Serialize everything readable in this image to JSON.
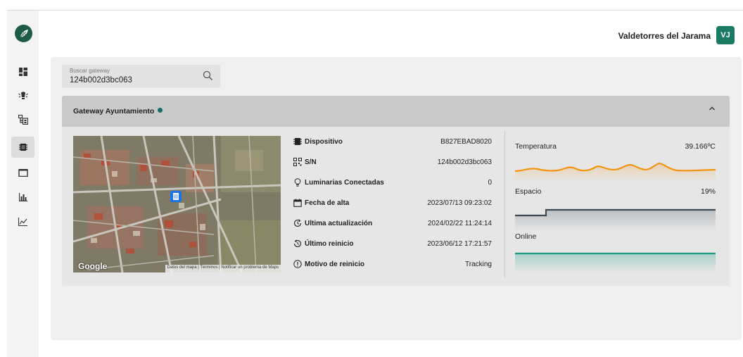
{
  "header": {
    "user_name": "Valdetorres del Jarama",
    "avatar_initials": "VJ"
  },
  "sidebar": {
    "items": [
      {
        "icon": "dashboard-icon",
        "active": false
      },
      {
        "icon": "alert-lamp-icon",
        "active": false
      },
      {
        "icon": "hierarchy-icon",
        "active": false
      },
      {
        "icon": "gateway-icon",
        "active": true
      },
      {
        "icon": "window-icon",
        "active": false
      },
      {
        "icon": "bar-chart-icon",
        "active": false
      },
      {
        "icon": "line-chart-icon",
        "active": false
      }
    ]
  },
  "search": {
    "label": "Buscar gateway",
    "value": "124b002d3bc063"
  },
  "gateway": {
    "title": "Gateway Ayuntamiento",
    "status_color": "#176b6b",
    "map": {
      "brand": "Google",
      "attribution": "Datos del mapa | Términos | Notificar un problema de Maps"
    },
    "info": [
      {
        "icon": "device-icon",
        "label": "Dispositivo",
        "value": "B827EBAD8020"
      },
      {
        "icon": "qr-icon",
        "label": "S/N",
        "value": "124b002d3bc063"
      },
      {
        "icon": "bulb-icon",
        "label": "Luminarias Conectadas",
        "value": "0"
      },
      {
        "icon": "calendar-icon",
        "label": "Fecha de alta",
        "value": "2023/07/13 09:23:02"
      },
      {
        "icon": "refresh-icon",
        "label": "Ultima actualización",
        "value": "2024/02/22 11:24:14"
      },
      {
        "icon": "restart-icon",
        "label": "Último reinicio",
        "value": "2023/06/12 17:21:57"
      },
      {
        "icon": "info-circle-icon",
        "label": "Motivo de reinicio",
        "value": "Tracking"
      }
    ],
    "metrics": {
      "temperatura": {
        "label": "Temperatura",
        "value": "39.166ºC",
        "color": "#f2940f"
      },
      "espacio": {
        "label": "Espacio",
        "value": "19%",
        "color": "#3d4a55"
      },
      "online": {
        "label": "Online",
        "color": "#1a9a84"
      }
    }
  }
}
